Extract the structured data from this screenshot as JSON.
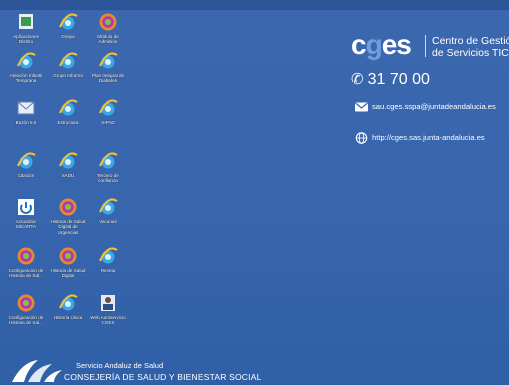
{
  "desktop": {
    "icons": [
      {
        "label": "Aplicaciones Distrito",
        "icon": "app-window-icon"
      },
      {
        "label": "Diraya",
        "icon": "ie-icon"
      },
      {
        "label": "Módulo de Admisión",
        "icon": "gear-app-icon"
      },
      {
        "label": "Atención Infantil Temprana",
        "icon": "ie-icon"
      },
      {
        "label": "Grupo Informa",
        "icon": "ie-icon"
      },
      {
        "label": "Plan Integral de Diabetes",
        "icon": "ie-icon"
      },
      {
        "label": "Buzón 5.0",
        "icon": "mail-icon"
      },
      {
        "label": "Estructura",
        "icon": "ie-icon"
      },
      {
        "label": "SIPAD",
        "icon": "ie-icon"
      },
      {
        "label": "Citación",
        "icon": "ie-icon"
      },
      {
        "label": "SADU",
        "icon": "ie-icon"
      },
      {
        "label": "Tercero de confianza",
        "icon": "ie-icon"
      },
      {
        "label": "Actualizar MiCARTA",
        "icon": "update-icon"
      },
      {
        "label": "Historia de Salud Digital de Urgencias",
        "icon": "gear-app-icon"
      },
      {
        "label": "Vacunas",
        "icon": "ie-icon"
      },
      {
        "label": "Configuración de Historia de Sal...",
        "icon": "gear-app-icon"
      },
      {
        "label": "Historia de Salud Digital",
        "icon": "gear-app-icon"
      },
      {
        "label": "Receta",
        "icon": "ie-icon"
      },
      {
        "label": "Configuración de Historia de Sal...",
        "icon": "gear-app-icon"
      },
      {
        "label": "Historia Única",
        "icon": "ie-icon"
      },
      {
        "label": "Web Autoservicio CGES",
        "icon": "person-icon"
      }
    ]
  },
  "brand": {
    "logo_text_a": "c",
    "logo_text_b": "g",
    "logo_text_c": "es",
    "title_line1": "Centro de Gestión",
    "title_line2": "de Servicios TIC"
  },
  "contact": {
    "phone": "31 70 00",
    "email": "sau.cges.sspa@juntadeandalucia.es",
    "web": "http://cges.sas.junta-andalucia.es"
  },
  "footer": {
    "line1": "Servicio Andaluz de Salud",
    "line2": "CONSEJERÍA DE SALUD Y BIENESTAR SOCIAL"
  },
  "colors": {
    "desktop_bg": "#3866ae",
    "logo_accent": "#6ea0e0"
  }
}
